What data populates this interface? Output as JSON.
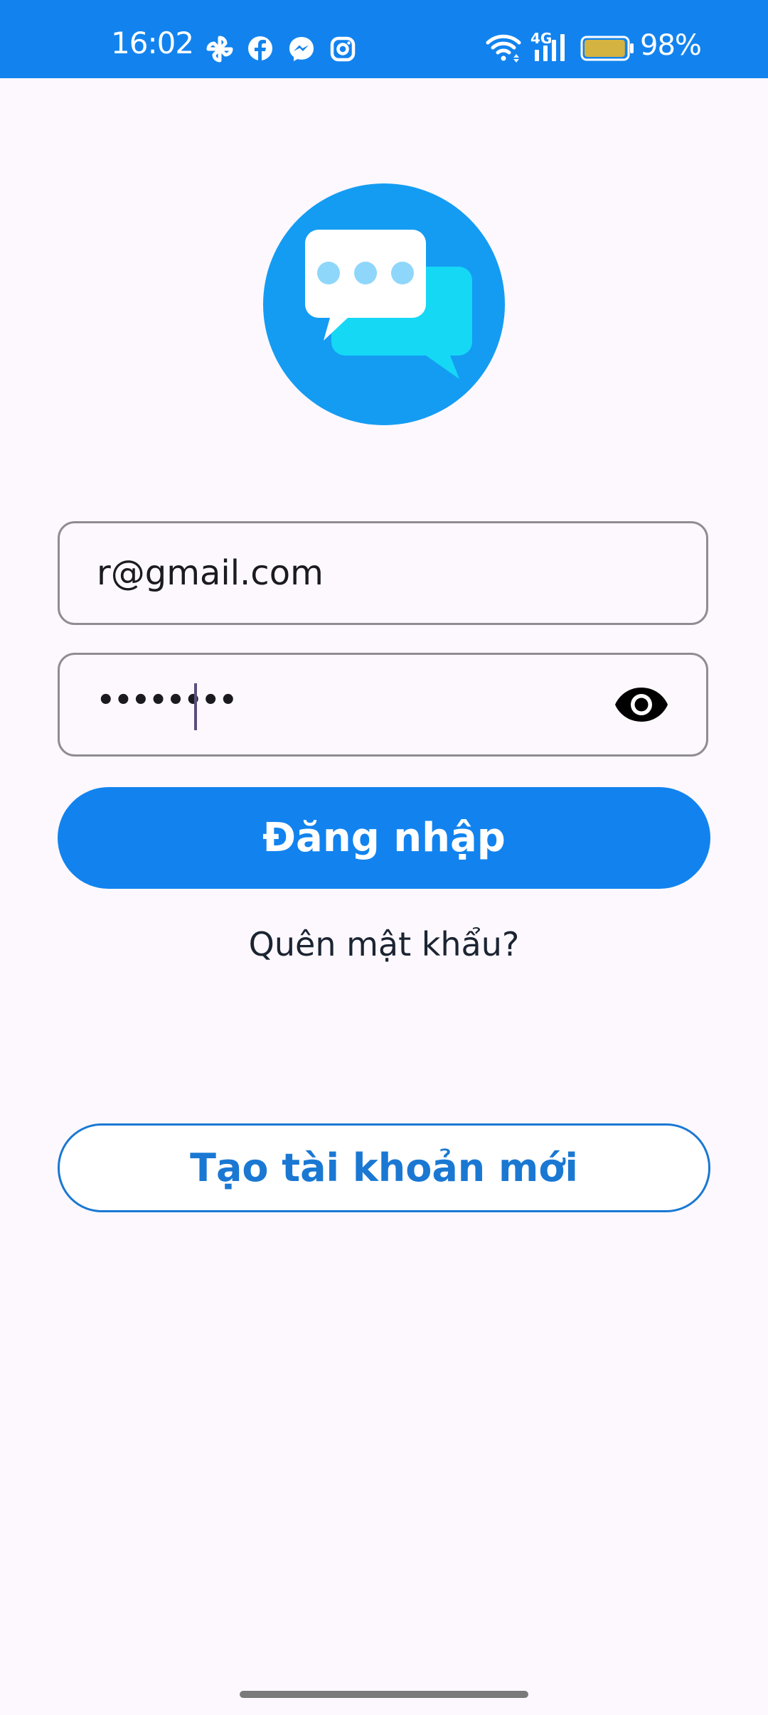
{
  "status_bar": {
    "time": "16:02",
    "battery_percent": "98%",
    "network_label": "4G",
    "battery_level": 0.98,
    "icons": [
      "pinwheel-icon",
      "facebook-icon",
      "messenger-icon",
      "instagram-icon",
      "wifi-icon",
      "cellular-signal-icon",
      "battery-icon"
    ]
  },
  "logo": {
    "icon": "chat-bubbles-icon",
    "colors": {
      "circle": "#149cf3",
      "front_bubble": "#ffffff",
      "back_bubble": "#15d8f5",
      "dots": "#8fd6fb"
    }
  },
  "login_form": {
    "email_value": "r@gmail.com",
    "password_masked": "••••••••",
    "password_toggle_icon": "eye-icon",
    "login_label": "Đăng nhập",
    "forgot_password_label": "Quên mật khẩu?",
    "create_account_label": "Tạo tài khoản mới"
  },
  "colors": {
    "primary": "#1283ee",
    "primary_dark": "#1a78d3",
    "background": "#fdf8fd",
    "field_border": "#8f8c93",
    "text": "#1b2432"
  }
}
